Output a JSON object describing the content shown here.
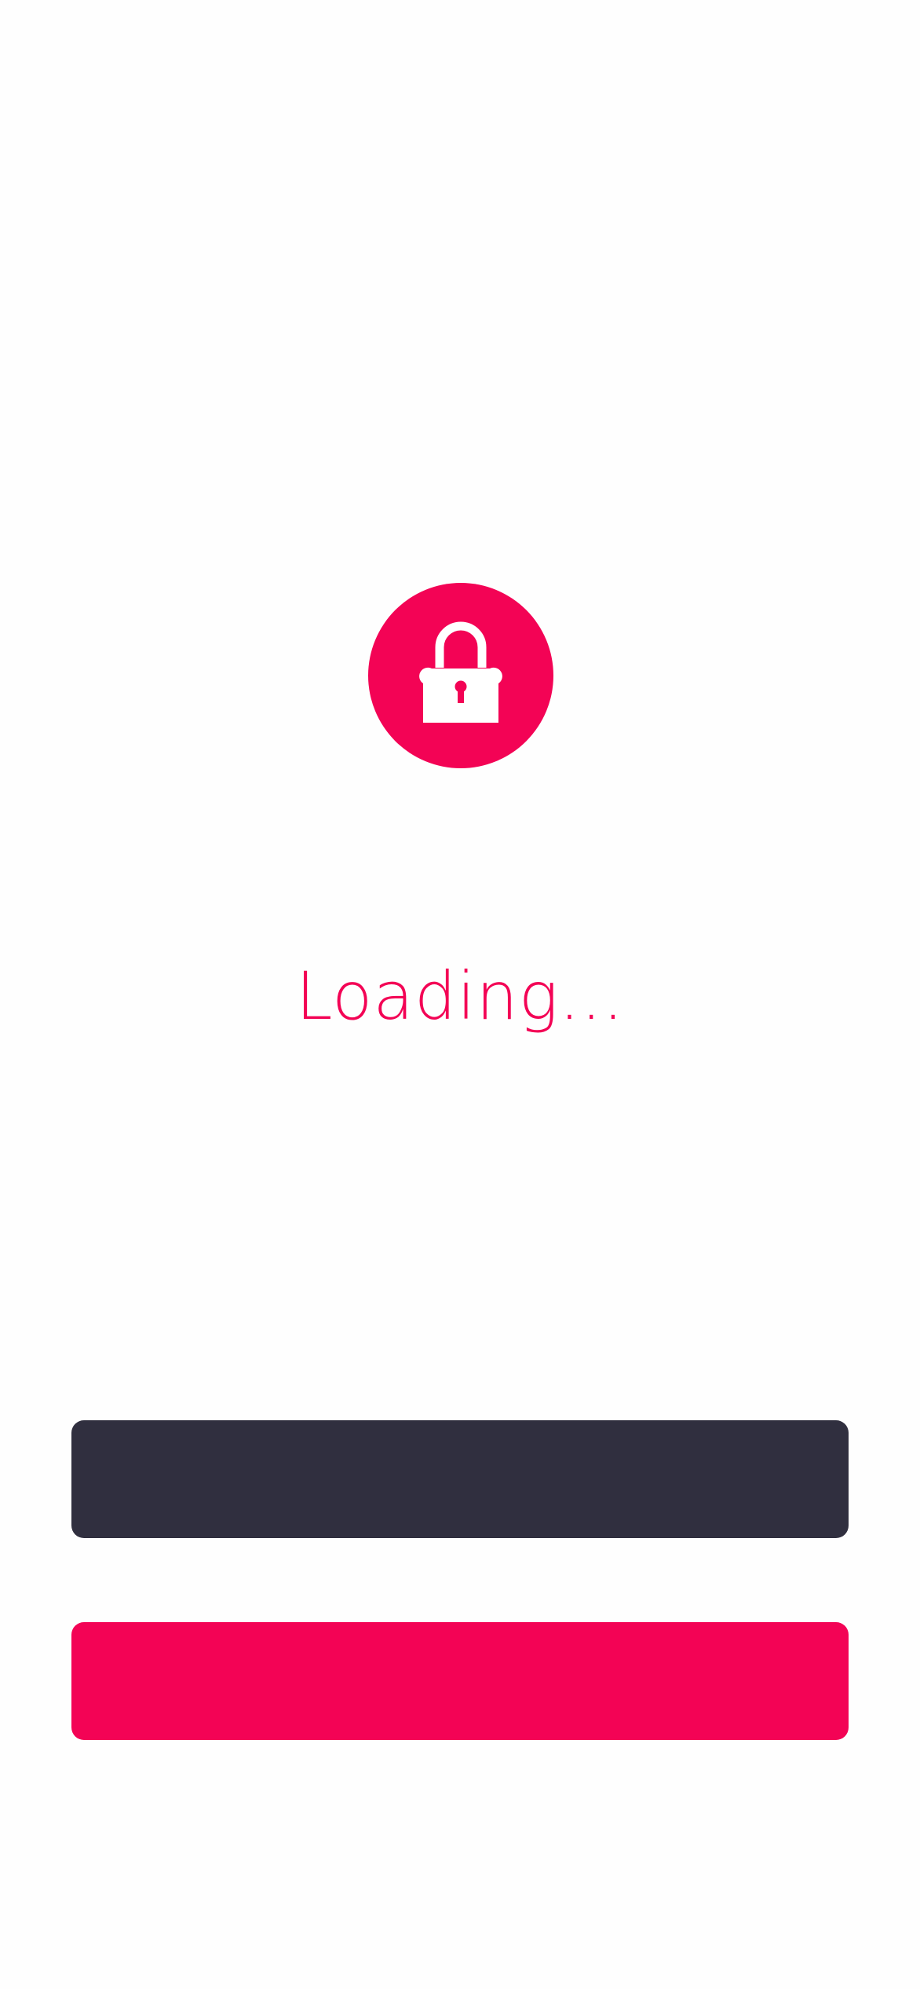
{
  "loading": {
    "text": "Loading..."
  },
  "icons": {
    "badge": "lock-icon"
  },
  "buttons": {
    "primary_label": "",
    "secondary_label": ""
  },
  "colors": {
    "accent": "#F30355",
    "dark": "#302F3F",
    "background": "#FEFEFE",
    "icon": "#FFFFFF"
  }
}
